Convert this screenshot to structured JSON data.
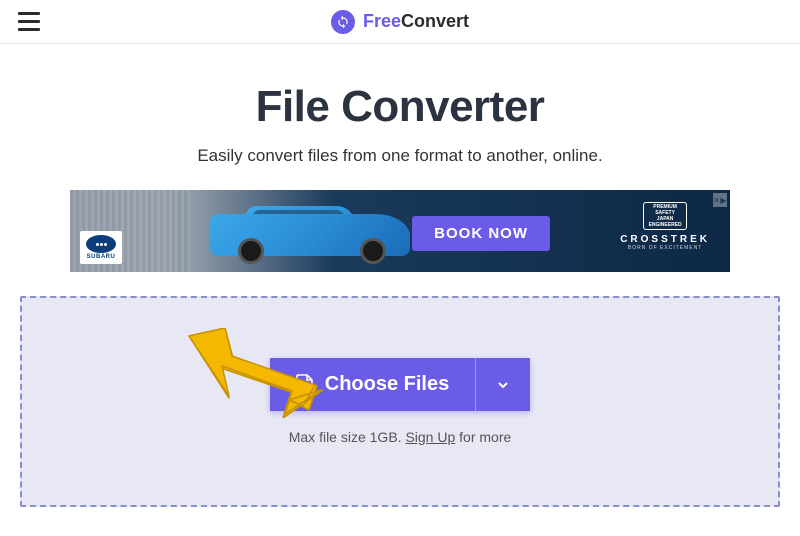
{
  "header": {
    "brand_free": "Free",
    "brand_convert": "Convert"
  },
  "main": {
    "title": "File Converter",
    "subtitle": "Easily convert files from one format to another, online."
  },
  "ad": {
    "brand_badge": "SUBARU",
    "cta": "BOOK NOW",
    "emblem_line1": "PREMIUM",
    "emblem_line2": "SAFETY",
    "emblem_line3": "JAPAN",
    "emblem_line4": "ENGINEERED",
    "model": "CROSSTREK",
    "tagline": "BORN OF EXCITEMENT"
  },
  "dropzone": {
    "choose_label": "Choose Files",
    "hint_prefix": "Max file size 1GB. ",
    "signup_text": "Sign Up",
    "hint_suffix": " for more"
  }
}
